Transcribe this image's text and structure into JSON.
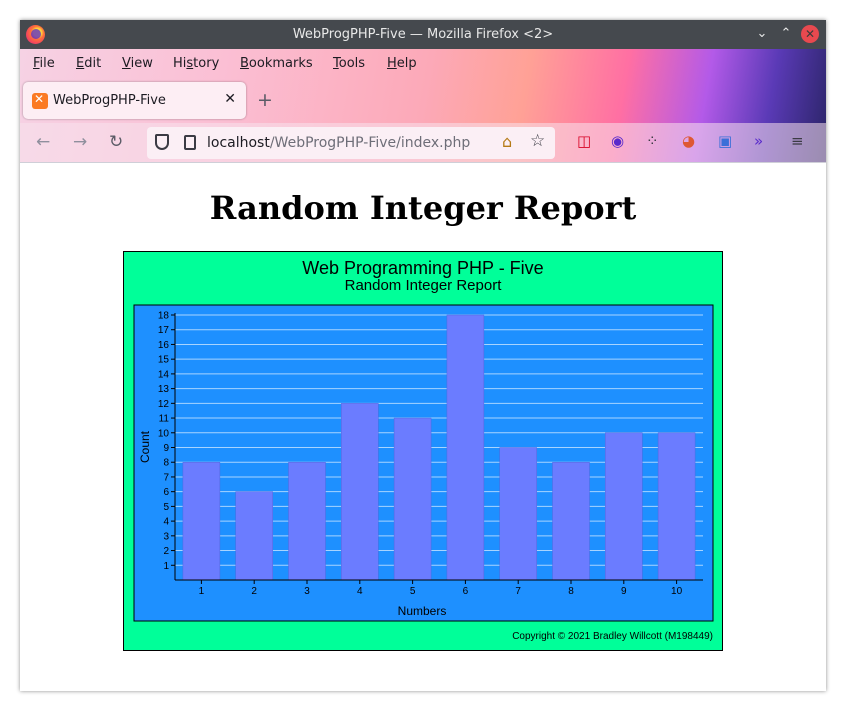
{
  "window": {
    "title": "WebProgPHP-Five — Mozilla Firefox <2>"
  },
  "menu": {
    "items": [
      {
        "label": "File",
        "u": "F",
        "rest": "ile"
      },
      {
        "label": "Edit",
        "u": "E",
        "rest": "dit"
      },
      {
        "label": "View",
        "u": "V",
        "rest": "iew"
      },
      {
        "label": "History",
        "pre": "Hi",
        "u": "s",
        "rest": "tory"
      },
      {
        "label": "Bookmarks",
        "u": "B",
        "rest": "ookmarks"
      },
      {
        "label": "Tools",
        "u": "T",
        "rest": "ools"
      },
      {
        "label": "Help",
        "u": "H",
        "rest": "elp"
      }
    ]
  },
  "tab": {
    "label": "WebProgPHP-Five"
  },
  "url": {
    "host": "localhost",
    "path": "/WebProgPHP-Five/index.php"
  },
  "page": {
    "heading": "Random Integer Report"
  },
  "colors": {
    "report_bg": "#00ff99",
    "plot_bg": "#1e90ff",
    "bar_fill": "#6b7cff",
    "grid": "#a8d4ff"
  },
  "chart_data": {
    "type": "bar",
    "title": "Web Programming PHP - Five",
    "subtitle": "Random Integer Report",
    "xlabel": "Numbers",
    "ylabel": "Count",
    "categories": [
      "1",
      "2",
      "3",
      "4",
      "5",
      "6",
      "7",
      "8",
      "9",
      "10"
    ],
    "values": [
      8,
      6,
      8,
      12,
      11,
      18,
      9,
      8,
      10,
      10
    ],
    "ylim": [
      0,
      18
    ],
    "yticks": [
      1,
      2,
      3,
      4,
      5,
      6,
      7,
      8,
      9,
      10,
      11,
      12,
      13,
      14,
      15,
      16,
      17,
      18
    ],
    "grid": true,
    "footer": "Copyright © 2021 Bradley Willcott (M198449)"
  }
}
